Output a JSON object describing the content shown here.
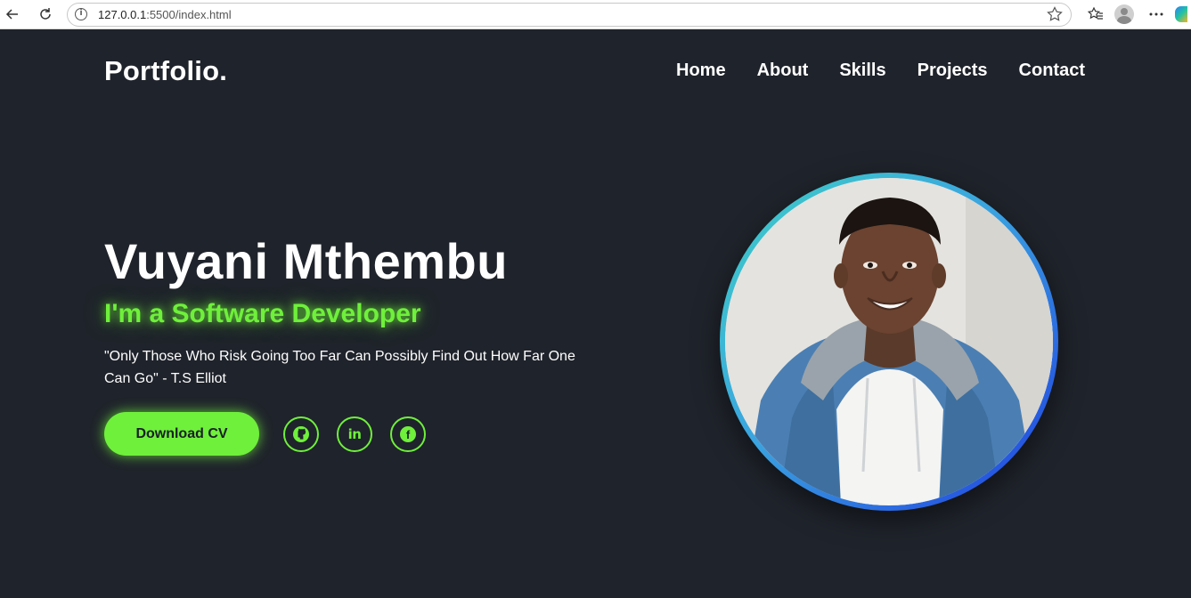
{
  "browser": {
    "url_host": "127.0.0.1",
    "url_rest": ":5500/index.html",
    "info_icon": "i"
  },
  "header": {
    "logo": "Portfolio.",
    "nav": [
      {
        "label": "Home"
      },
      {
        "label": "About"
      },
      {
        "label": "Skills"
      },
      {
        "label": "Projects"
      },
      {
        "label": "Contact"
      }
    ]
  },
  "hero": {
    "name": "Vuyani Mthembu",
    "role": "I'm a Software Developer",
    "quote": "\"Only Those Who Risk Going Too Far Can Possibly Find Out How Far One Can Go\" - T.S Elliot",
    "cv_button": "Download CV",
    "socials": [
      {
        "name": "github",
        "icon": "github-icon",
        "glyph": "⌥"
      },
      {
        "name": "linkedin",
        "icon": "linkedin-icon",
        "glyph": "in"
      },
      {
        "name": "facebook",
        "icon": "facebook-icon",
        "glyph": "f"
      }
    ]
  },
  "colors": {
    "background": "#1f232b",
    "accent": "#6ff03b",
    "text": "#ffffff",
    "ring_start": "#3fd0c4",
    "ring_end": "#1f3be0"
  }
}
